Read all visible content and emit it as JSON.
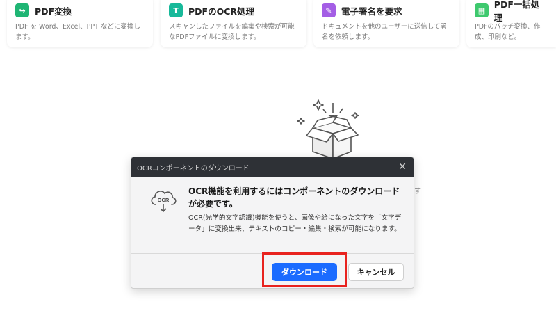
{
  "cards": [
    {
      "title": "PDF変換",
      "desc": "PDF を Word、Excel、PPT などに変換します。",
      "icon": "convert-icon",
      "color": "#1fb574",
      "glyph": "↪"
    },
    {
      "title": "PDFのOCR処理",
      "desc": "スキャンしたファイルを編集や検索が可能なPDFファイルに変換します。",
      "icon": "ocr-icon",
      "color": "#18b99a",
      "glyph": "T"
    },
    {
      "title": "電子署名を要求",
      "desc": "ドキュメントを他のユーザーに送信して署名を依頼します。",
      "icon": "signature-icon",
      "color": "#a45ee5",
      "glyph": "✎"
    },
    {
      "title": "PDF一括処理",
      "desc": "PDFのバッチ変換、作成、印刷など。",
      "icon": "batch-icon",
      "color": "#3ec96e",
      "glyph": "▦"
    }
  ],
  "background": {
    "partial_text": "す"
  },
  "dialog": {
    "title": "OCRコンポーネントのダウンロード",
    "icon_label": "OCR",
    "heading": "OCR機能を利用するにはコンポーネントのダウンロードが必要です。",
    "body": "OCR(光学的文字認識)機能を使うと、画像や絵になった文字を「文字データ」に変換出来、テキストのコピー・編集・検索が可能になります。",
    "download_label": "ダウンロード",
    "cancel_label": "キャンセル",
    "close_glyph": "✕"
  },
  "colors": {
    "primary": "#1b6bff",
    "titlebar": "#2e3136",
    "highlight": "#e8231f"
  }
}
